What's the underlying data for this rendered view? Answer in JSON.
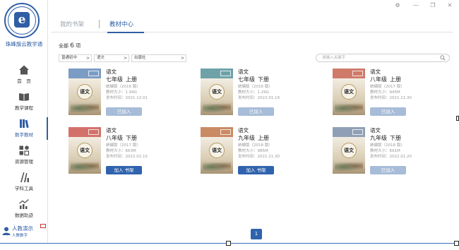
{
  "app": {
    "logo_text": "珠峰旗云教学通",
    "name": "珠峰旗云教学通"
  },
  "window_controls": [
    "gear-icon",
    "minimize-icon",
    "restore-icon",
    "close-icon"
  ],
  "sidebar": {
    "items": [
      {
        "label": "首　页",
        "icon": "home-icon",
        "active": false
      },
      {
        "label": "教学课程",
        "icon": "book-open-icon",
        "active": false
      },
      {
        "label": "数字教材",
        "icon": "bookshelf-icon",
        "active": true
      },
      {
        "label": "资源管理",
        "icon": "resources-icon",
        "active": false
      },
      {
        "label": "学科工具",
        "icon": "tools-icon",
        "active": false
      },
      {
        "label": "数据轨迹",
        "icon": "chart-icon",
        "active": false
      }
    ],
    "user": {
      "name": "人教演示",
      "org": "人教数字"
    }
  },
  "tabs": [
    {
      "label": "我的书架",
      "active": false
    },
    {
      "label": "教材中心",
      "active": true
    }
  ],
  "summary": {
    "prefix": "全部",
    "count": "6",
    "suffix": "项"
  },
  "filters": [
    {
      "value": "普通初中"
    },
    {
      "value": "语文"
    },
    {
      "value": "出版社"
    }
  ],
  "search": {
    "placeholder": "请输入关键字"
  },
  "books": [
    {
      "subject": "语文",
      "grade": "七年级",
      "volume": "上册",
      "edition": "统编版（2016 版）",
      "size": "教材大小：1.94G",
      "date": "发布时间：2021.12.01",
      "action": "已加入",
      "added": true,
      "band_color": "#7b9cc4"
    },
    {
      "subject": "语文",
      "grade": "七年级",
      "volume": "下册",
      "edition": "统编版（2016 版）",
      "size": "教材大小：1.29G",
      "date": "发布时间：2022.01.19",
      "action": "已加入",
      "added": true,
      "band_color": "#6ea2a8"
    },
    {
      "subject": "语文",
      "grade": "八年级",
      "volume": "上册",
      "edition": "统编版（2017 版）",
      "size": "教材大小：945M",
      "date": "发布时间：2021.11.30",
      "action": "已加入",
      "added": true,
      "band_color": "#d07a6a"
    },
    {
      "subject": "语文",
      "grade": "八年级",
      "volume": "下册",
      "edition": "统编版（2017 版）",
      "size": "教材大小：663M",
      "date": "发布时间：2022.02.15",
      "action": "加入 书架",
      "added": false,
      "band_color": "#d2716a"
    },
    {
      "subject": "语文",
      "grade": "九年级",
      "volume": "上册",
      "edition": "统编版（2018 版）",
      "size": "教材大小：985M",
      "date": "发布时间：2021.11.30",
      "action": "加入 书架",
      "added": false,
      "band_color": "#c98a64"
    },
    {
      "subject": "语文",
      "grade": "九年级",
      "volume": "下册",
      "edition": "统编版（2018 版）",
      "size": "教材大小：691M",
      "date": "发布时间：2022.01.20",
      "action": "已加入",
      "added": true,
      "band_color": "#8fa0b6"
    }
  ],
  "cover_seal": "语文",
  "pagination": {
    "current": "1"
  }
}
